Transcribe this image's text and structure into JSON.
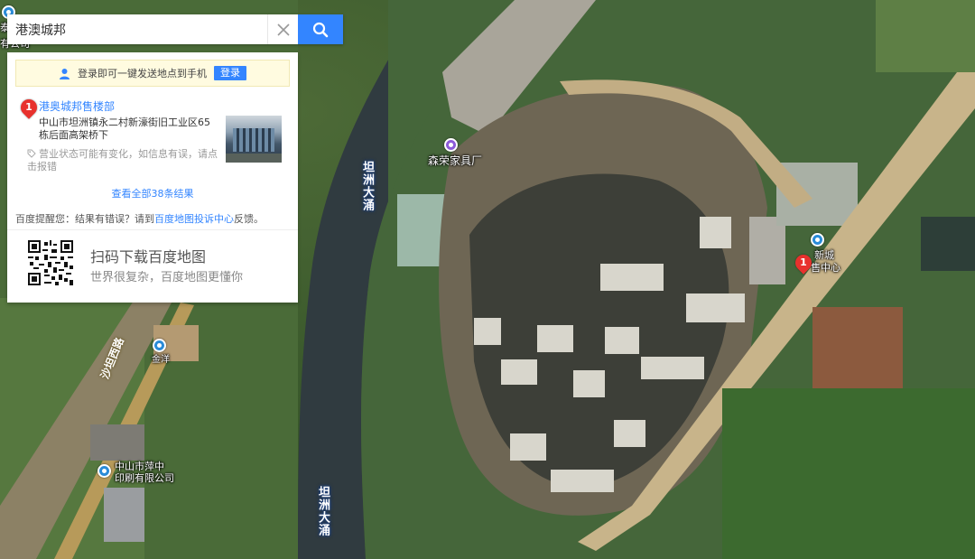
{
  "search": {
    "value": "港澳城邦",
    "clear_icon": "close-icon",
    "search_icon": "search-icon"
  },
  "panel": {
    "login_text": "登录即可一键发送地点到手机",
    "login_button": "登录",
    "result": {
      "index": "1",
      "title": "港奥城邦售楼部",
      "address": "中山市坦洲镇永二村新濠街旧工业区65栋后面高架桥下",
      "note": "营业状态可能有变化，如信息有误，请点击报错"
    },
    "view_all": "查看全部38条结果",
    "tip_prefix": "百度提醒您：结果有错误？请到",
    "tip_link": "百度地图投诉中心",
    "tip_suffix": "反馈。",
    "qr_title": "扫码下载百度地图",
    "qr_subtitle": "世界很复杂，百度地图更懂你"
  },
  "map": {
    "labels": {
      "river_1": "坦洲大涌",
      "river_2": "坦洲大涌",
      "road": "沙坦西路",
      "poi_furniture": "森荣家具厂",
      "poi_jinyang": "金洋",
      "poi_printing_line1": "中山市萍中",
      "poi_printing_line2": "印刷有限公司",
      "poi_sales_line1": "新城",
      "poi_sales_line2": "售中心",
      "partial_top_left_1": "泰",
      "partial_top_left_2": "有公司",
      "pin_index": "1"
    }
  }
}
